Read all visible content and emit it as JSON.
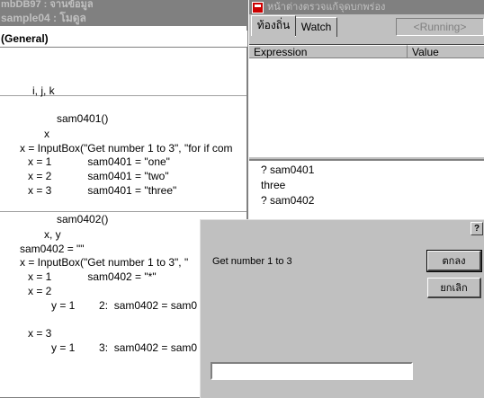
{
  "code_window": {
    "back_title": "mbDB97 : จานข้อมูล",
    "title": "sample04 : โมดูล",
    "object_combo": "(General)",
    "lines": [
      "i, j, k",
      "sam0401()",
      "x",
      "x = InputBox(\"Get number 1 to 3\", \"for if com",
      "x = 1            sam0401 = \"one\"",
      "x = 2            sam0401 = \"two\"",
      "x = 3            sam0401 = \"three\"",
      "sam0402()",
      "x, y",
      "sam0402 = \"\"",
      "x = InputBox(\"Get number 1 to 3\", \"",
      "x = 1            sam0402 = \"*\"",
      "x = 2",
      "y = 1        2:  sam0402 = sam0",
      "x = 3",
      "y = 1        3:  sam0402 = sam0"
    ]
  },
  "debug_window": {
    "title": "หน้าต่างตรวจแก้จุดบกพร่อง",
    "tabs": [
      "ท้องถิ่น",
      "Watch"
    ],
    "status": "<Running>",
    "columns": [
      "Expression",
      "Value"
    ],
    "immediate_lines": [
      "? sam0401",
      "three",
      "? sam0402"
    ]
  },
  "dialog": {
    "help": "?",
    "prompt": "Get number 1 to 3",
    "ok_label": "ตกลง",
    "cancel_label": "ยกเลิก",
    "input_value": ""
  }
}
